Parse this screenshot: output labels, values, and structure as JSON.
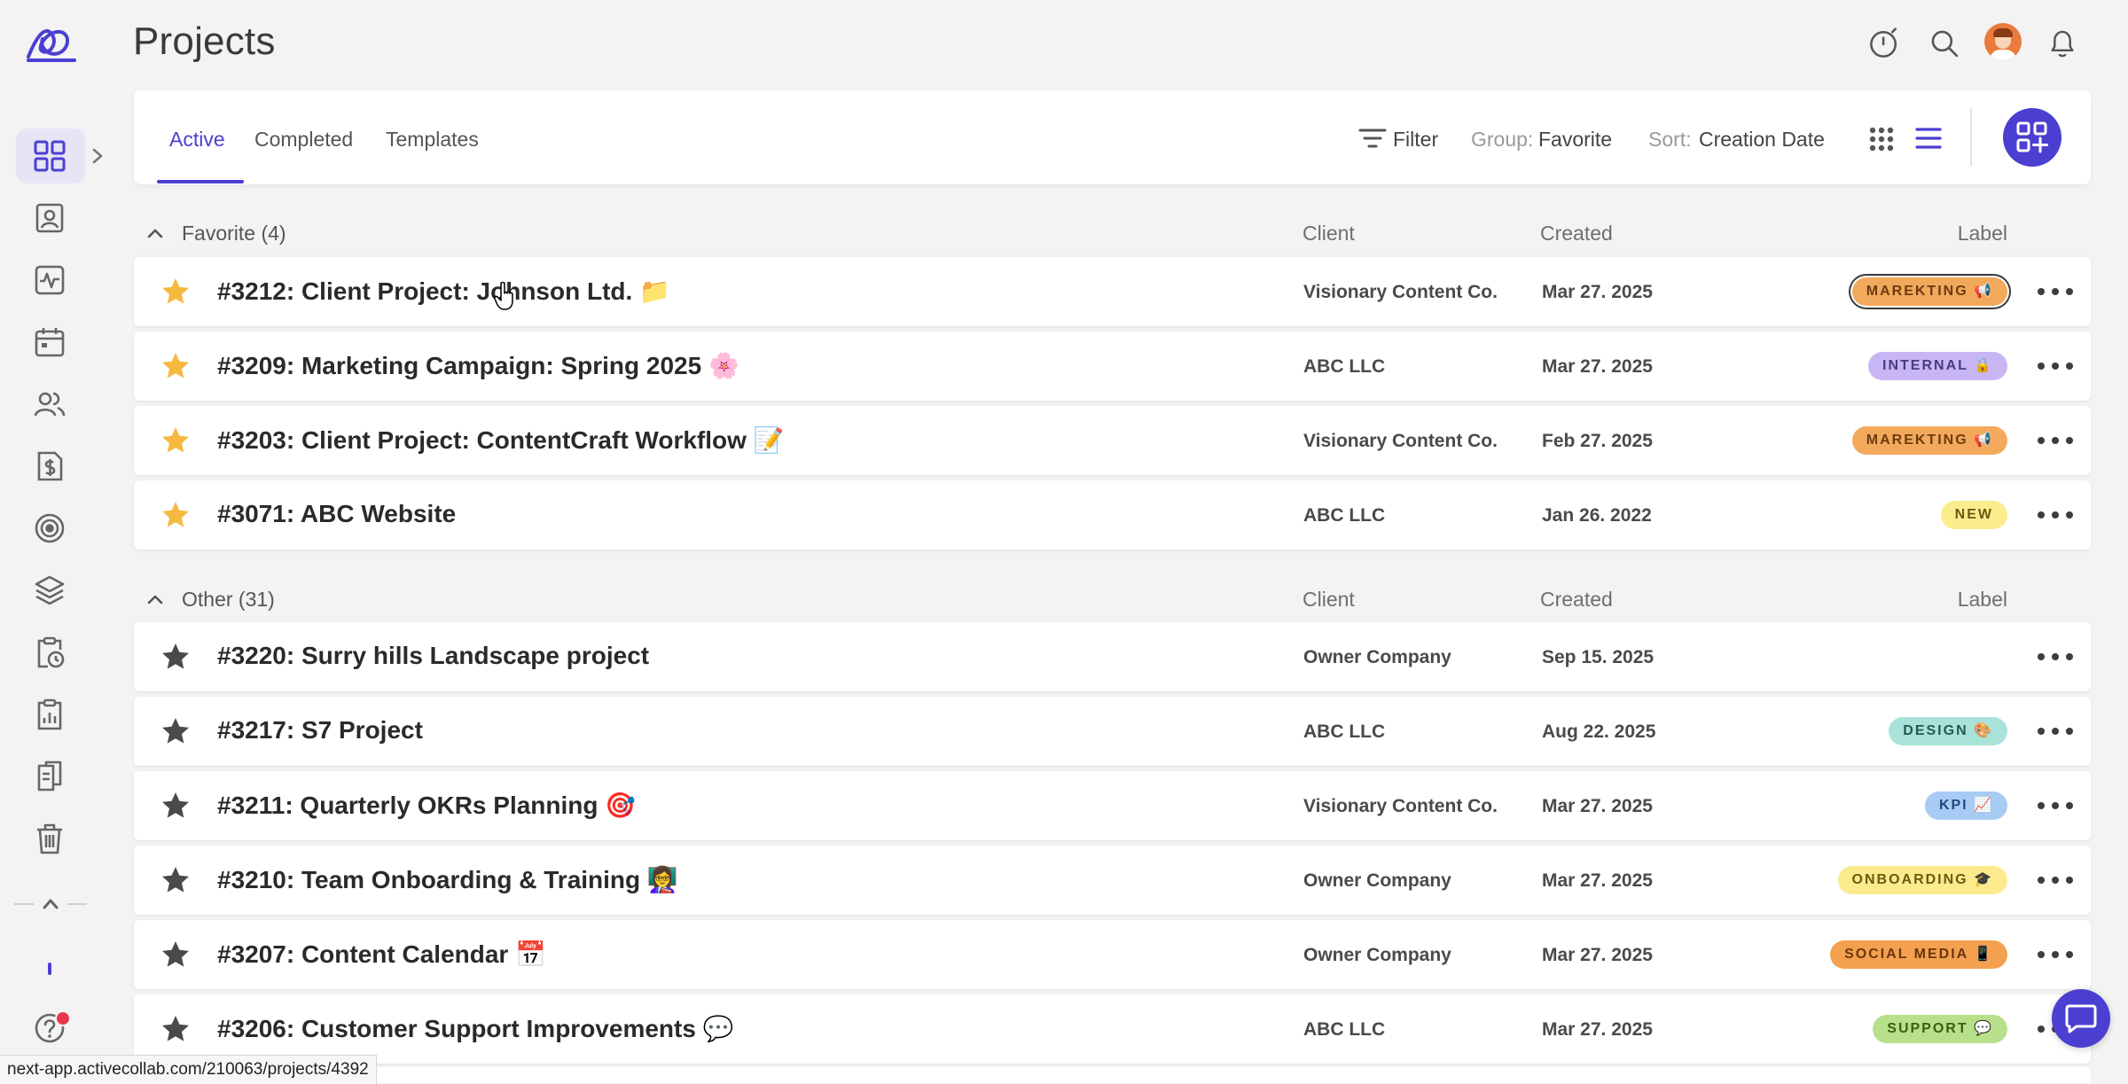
{
  "app": {
    "title": "Projects"
  },
  "sidebar": {
    "items": [
      {
        "name": "projects",
        "icon": "grid-icon",
        "active": true
      },
      {
        "name": "people",
        "icon": "contact-card-icon"
      },
      {
        "name": "activity",
        "icon": "activity-icon"
      },
      {
        "name": "calendar",
        "icon": "calendar-icon"
      },
      {
        "name": "team",
        "icon": "users-icon"
      },
      {
        "name": "invoices",
        "icon": "dollar-doc-icon"
      },
      {
        "name": "goals",
        "icon": "target-icon"
      },
      {
        "name": "layers",
        "icon": "layers-icon"
      },
      {
        "name": "time",
        "icon": "clipboard-clock-icon"
      },
      {
        "name": "reports",
        "icon": "clipboard-chart-icon"
      },
      {
        "name": "documents",
        "icon": "documents-icon"
      },
      {
        "name": "trash",
        "icon": "trash-icon"
      }
    ]
  },
  "toolbar": {
    "tabs": [
      {
        "label": "Active",
        "active": true
      },
      {
        "label": "Completed"
      },
      {
        "label": "Templates"
      }
    ],
    "filter_label": "Filter",
    "group_prefix": "Group:",
    "group_value": "Favorite",
    "sort_prefix": "Sort:",
    "sort_value": "Creation Date",
    "view_mode": "list"
  },
  "columns": {
    "client": "Client",
    "created": "Created",
    "label": "Label"
  },
  "groups": [
    {
      "title": "Favorite (4)",
      "rows": [
        {
          "name": "#3212: Client Project: Johnson Ltd. 📁",
          "client": "Visionary Content Co.",
          "created": "Mar 27. 2025",
          "label": "MAREKTING 📢",
          "label_bg": "#f3a95c",
          "label_fg": "#6b3b10",
          "favorite": true,
          "selected": true
        },
        {
          "name": "#3209: Marketing Campaign: Spring 2025 🌸",
          "client": "ABC LLC",
          "created": "Mar 27. 2025",
          "label": "INTERNAL 🔒",
          "label_bg": "#c8b6f4",
          "label_fg": "#4a3a86",
          "favorite": true
        },
        {
          "name": "#3203: Client Project: ContentCraft Workflow 📝",
          "client": "Visionary Content Co.",
          "created": "Feb 27. 2025",
          "label": "MAREKTING 📢",
          "label_bg": "#f3a95c",
          "label_fg": "#6b3b10",
          "favorite": true
        },
        {
          "name": "#3071: ABC Website",
          "client": "ABC LLC",
          "created": "Jan 26. 2022",
          "label": "NEW",
          "label_bg": "#fbec8e",
          "label_fg": "#6b5a10",
          "favorite": true
        }
      ]
    },
    {
      "title": "Other (31)",
      "rows": [
        {
          "name": "#3220: Surry hills Landscape project",
          "client": "Owner Company",
          "created": "Sep 15. 2025",
          "label": "",
          "favorite": false
        },
        {
          "name": "#3217: S7 Project",
          "client": "ABC LLC",
          "created": "Aug 22. 2025",
          "label": "DESIGN 🎨",
          "label_bg": "#a9e2d8",
          "label_fg": "#215a52",
          "favorite": false
        },
        {
          "name": "#3211: Quarterly OKRs Planning 🎯",
          "client": "Visionary Content Co.",
          "created": "Mar 27. 2025",
          "label": "KPI 📈",
          "label_bg": "#a8cbf4",
          "label_fg": "#1f4a80",
          "favorite": false
        },
        {
          "name": "#3210: Team Onboarding & Training 👩‍🏫",
          "client": "Owner Company",
          "created": "Mar 27. 2025",
          "label": "ONBOARDING 🎓",
          "label_bg": "#fbeb8c",
          "label_fg": "#6b5a10",
          "favorite": false
        },
        {
          "name": "#3207: Content Calendar 📅",
          "client": "Owner Company",
          "created": "Mar 27. 2025",
          "label": "SOCIAL MEDIA 📱",
          "label_bg": "#f3a14f",
          "label_fg": "#6b3610",
          "favorite": false
        },
        {
          "name": "#3206: Customer Support Improvements 💬",
          "client": "ABC LLC",
          "created": "Mar 27. 2025",
          "label": "SUPPORT 💬",
          "label_bg": "#b8e08a",
          "label_fg": "#3a5e14",
          "favorite": false
        }
      ]
    }
  ],
  "status_bar": {
    "url": "next-app.activecollab.com/210063/projects/4392"
  },
  "colors": {
    "accent": "#4b3fd1",
    "star_on": "#f5b942",
    "star_off": "#4a4a4a"
  }
}
